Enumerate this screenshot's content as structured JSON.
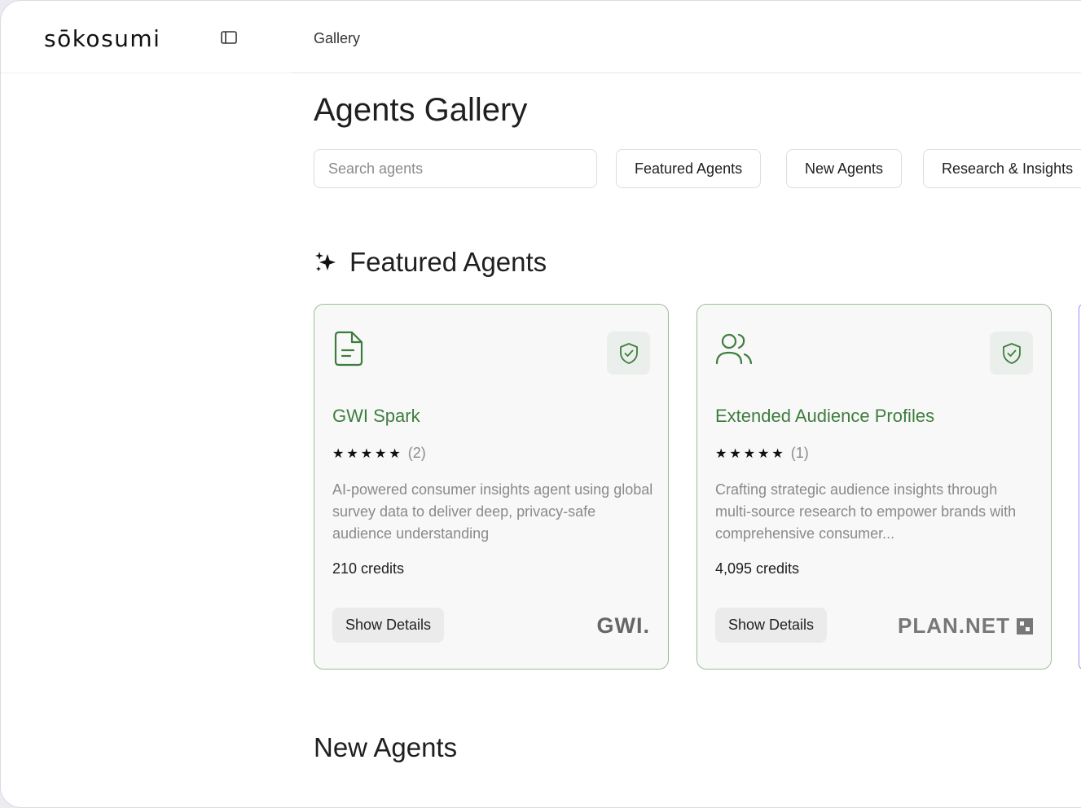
{
  "app": {
    "logo_text": "sōkosumi"
  },
  "header": {
    "breadcrumb": "Gallery"
  },
  "page": {
    "title": "Agents Gallery"
  },
  "search": {
    "placeholder": "Search agents",
    "value": ""
  },
  "filters": [
    {
      "label": "Featured Agents"
    },
    {
      "label": "New Agents"
    },
    {
      "label": "Research & Insights"
    }
  ],
  "sections": {
    "featured": {
      "title": "Featured Agents",
      "icon": "sparkles-icon"
    },
    "new": {
      "title": "New Agents"
    }
  },
  "cards": [
    {
      "icon": "document-icon",
      "title": "GWI Spark",
      "stars": "★★★★★",
      "rating_count": "(2)",
      "description": "AI-powered consumer insights agent using global survey data to deliver deep, privacy-safe audience understanding",
      "credits": "210 credits",
      "button_label": "Show Details",
      "brand": "GWI."
    },
    {
      "icon": "users-icon",
      "title": "Extended Audience Profiles",
      "stars": "★★★★★",
      "rating_count": "(1)",
      "description": "Crafting strategic audience insights through multi-source research to empower brands with comprehensive consumer...",
      "credits": "4,095 credits",
      "button_label": "Show Details",
      "brand": "PLAN.NET"
    }
  ],
  "colors": {
    "accent_green": "#3f7d3f",
    "card_border": "#9cbf97",
    "purple_edge": "#a78bfa"
  }
}
